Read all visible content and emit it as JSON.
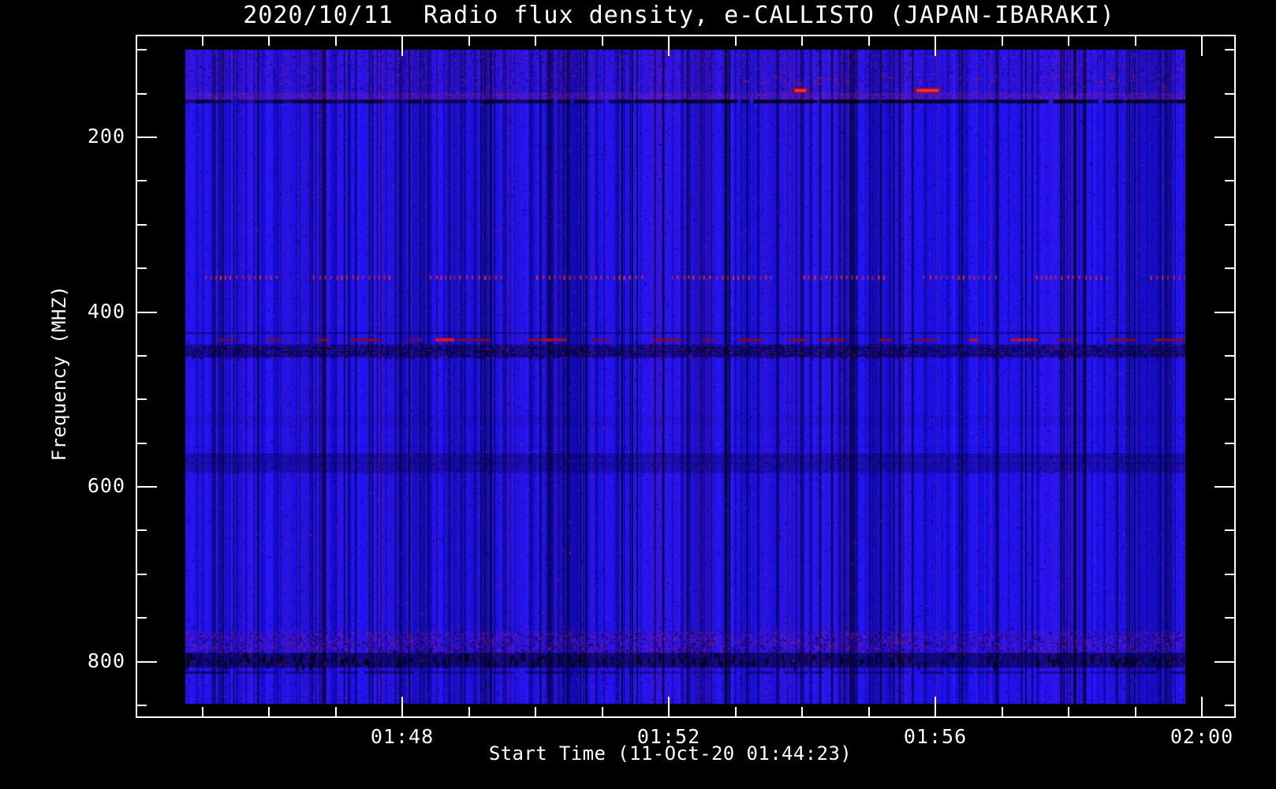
{
  "chart_data": {
    "type": "heatmap",
    "subtype": "radio-spectrogram",
    "title": "2020/10/11  Radio flux density, e-CALLISTO (JAPAN-IBARAKI)",
    "instrument": "e-CALLISTO (JAPAN-IBARAKI)",
    "date": "2020/10/11",
    "xlabel": "Start Time (11-Oct-20 01:44:23)",
    "ylabel": "Frequency (MHZ)",
    "axes": {
      "x": {
        "start": "01:44:00",
        "major_ticks": [
          {
            "label": "01:48",
            "minutes": 4
          },
          {
            "label": "01:52",
            "minutes": 8
          },
          {
            "label": "01:56",
            "minutes": 12
          },
          {
            "label": "02:00",
            "minutes": 16
          }
        ],
        "minor_every_minutes": 1,
        "minor_minute_range": [
          1,
          15
        ]
      },
      "y": {
        "major_ticks": [
          {
            "label": "200",
            "mhz": 200
          },
          {
            "label": "400",
            "mhz": 400
          },
          {
            "label": "600",
            "mhz": 600
          },
          {
            "label": "800",
            "mhz": 800
          }
        ],
        "minor_every_mhz": 50,
        "minor_range_mhz": [
          100,
          850
        ],
        "direction": "increasing-downward"
      }
    },
    "image_time_span": [
      "01:44:45",
      "01:59:45"
    ],
    "image_freq_span_mhz": [
      100,
      853
    ],
    "background_value": "quiet blue continuum with vertical scintillation striping",
    "features": [
      {
        "name": "upper-broadband-speckle",
        "freq_mhz": [
          100,
          152
        ],
        "description": "dense purple/red speckle noise across full time range"
      },
      {
        "name": "purple-band",
        "freq_mhz": [
          149,
          157
        ],
        "description": "purple interference band"
      },
      {
        "name": "dark-line",
        "freq_mhz": [
          157,
          161
        ],
        "description": "dark horizontal interference line, stronger on right half"
      },
      {
        "name": "red-burst-1",
        "freq_mhz": [
          144.5,
          148.5
        ],
        "start_time": "01:53:53",
        "duration_s": 11,
        "description": "bright red RFI burst"
      },
      {
        "name": "red-burst-2",
        "freq_mhz": [
          144.5,
          148.5
        ],
        "start_time": "01:55:43",
        "duration_s": 20,
        "description": "bright red RFI burst"
      },
      {
        "name": "dotted-line",
        "freq_mhz": 361,
        "description": "periodic red dotted interference line, groups of dots separated by gaps"
      },
      {
        "name": "faint-line",
        "freq_mhz": 424,
        "description": "faint dark horizontal line"
      },
      {
        "name": "maroon-dashes",
        "freq_mhz": 432,
        "description": "dark red dashed interference line with occasional bright red segments"
      },
      {
        "name": "noise-band-440",
        "freq_mhz": [
          437,
          452
        ],
        "description": "dark speckled noise band"
      },
      {
        "name": "subtle-band-570",
        "freq_mhz": [
          562,
          584
        ],
        "description": "subtle dark noisy band"
      },
      {
        "name": "lower-speckle-band",
        "freq_mhz": [
          752,
          790
        ],
        "description": "speckled purple/red noise band"
      },
      {
        "name": "lower-dark-band",
        "freq_mhz": [
          790,
          807
        ],
        "description": "dark noise band with black vertical dashes and red specks"
      },
      {
        "name": "lower-dark-row",
        "freq_mhz": [
          811,
          814
        ],
        "description": "thin dark row"
      }
    ],
    "palette": {
      "background": "#000000",
      "foreground": "#ffffff",
      "base": "#1f12ee",
      "base_light": "#2b1bf7",
      "base_dark": "#150cd6",
      "navy": "#0c07a8",
      "deep": "#060356",
      "near_black": "#02021c",
      "purple": "#6a14d2",
      "magenta": "#a727c9",
      "red_bright": "#ff1410",
      "red": "#d42420",
      "maroon": "#8c0a10"
    }
  }
}
